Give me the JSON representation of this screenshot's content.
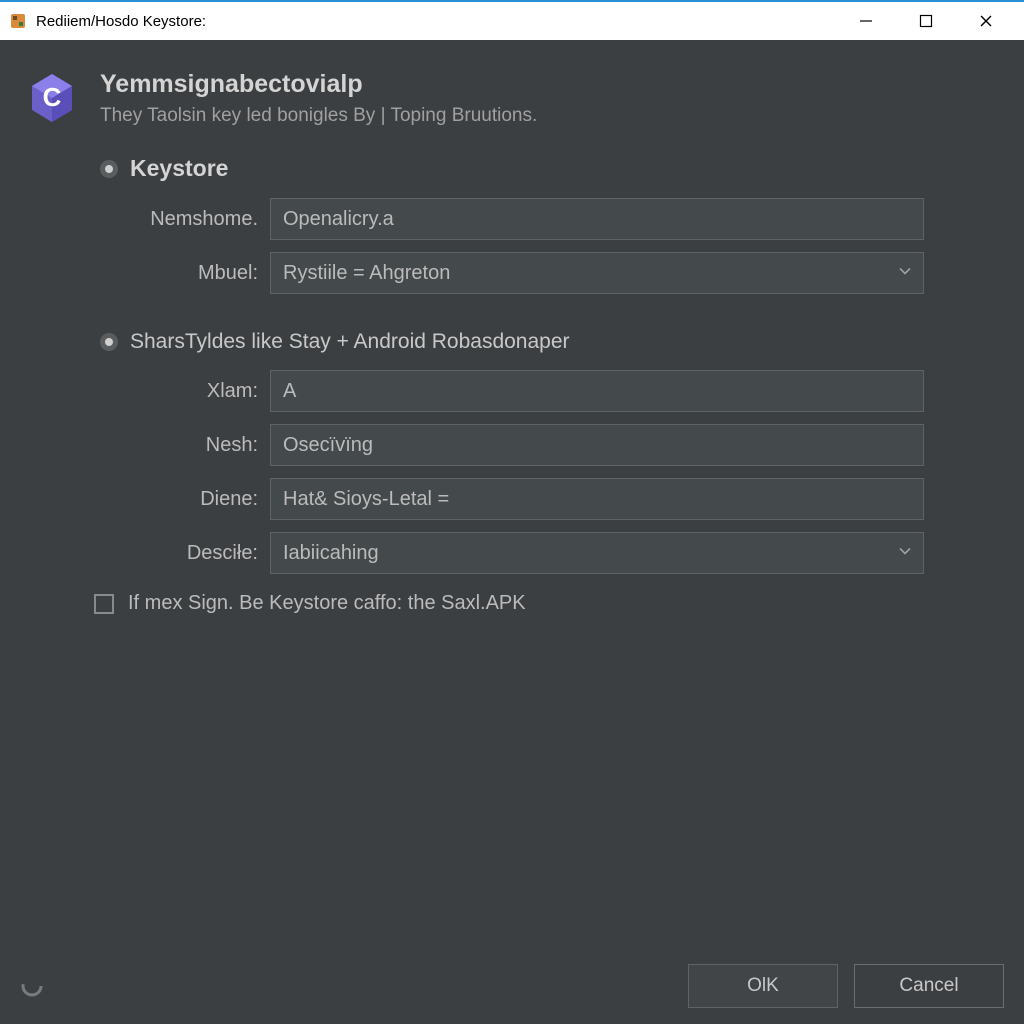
{
  "window": {
    "title": "Rediiem/Hosdo Keystore:"
  },
  "header": {
    "title": "Yemmsignabectovialp",
    "subtitle": "They Taolsin key led bonigles By | Toping Bruutions."
  },
  "section1": {
    "title": "Keystore",
    "fields": {
      "nemshome": {
        "label": "Nemshome.",
        "value": "Openalicry.a"
      },
      "mbuel": {
        "label": "Mbuel:",
        "value": "Rystiile = Ahgreton"
      }
    }
  },
  "section2": {
    "title": "SharsTyldes like Stay + Android Robasdonaper",
    "fields": {
      "xlam": {
        "label": "Xlam:",
        "value": "A"
      },
      "nesh": {
        "label": "Nesh:",
        "value": "Osecïvïng"
      },
      "diene": {
        "label": "Diene:",
        "value": "Hat& Sioys-Letal ="
      },
      "descile": {
        "label": "Desciłe:",
        "value": "Iabiicahing"
      }
    }
  },
  "checkbox": {
    "label": "If mex Sign. Be Keystore caffo: the Saxl.APK"
  },
  "footer": {
    "ok": "OlK",
    "cancel": "Cancel"
  }
}
